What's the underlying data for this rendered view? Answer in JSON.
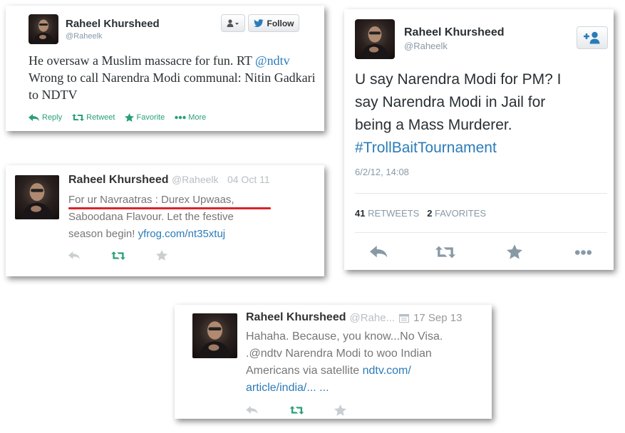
{
  "tweet1": {
    "name": "Raheel Khursheed",
    "handle": "@Raheelk",
    "follow_label": "Follow",
    "text_before": "He oversaw a Muslim massacre for fun. RT",
    "mention": "@ndtv",
    "text_after": "Wrong to call Narendra Modi communal: Nitin Gadkari to NDTV",
    "actions": {
      "reply": "Reply",
      "retweet": "Retweet",
      "favorite": "Favorite",
      "more": "More"
    }
  },
  "tweet2": {
    "name": "Raheel Khursheed",
    "handle": "@Raheelk",
    "text_line1": "U say Narendra Modi for PM? I",
    "text_line2": "say Narendra Modi in Jail for",
    "text_line3": "being a Mass Murderer.",
    "hashtag": "#TrollBaitTournament",
    "timestamp": "6/2/12, 14:08",
    "retweets_count": "41",
    "retweets_label": "RETWEETS",
    "favorites_count": "2",
    "favorites_label": "FAVORITES"
  },
  "tweet3": {
    "name": "Raheel Khursheed",
    "handle": "@Raheelk",
    "date": "04 Oct 11",
    "text_line1": "For ur Navraatras : Durex Upwaas,",
    "text_line2": "Saboodana Flavour. Let the festive",
    "text_line3_plain": "season begin!",
    "text_link": "yfrog.com/nt35xtuj"
  },
  "tweet4": {
    "name": "Raheel Khursheed",
    "handle": "@Rahe...",
    "date": "17 Sep 13",
    "text_line1": "Hahaha. Because, you know...No Visa.",
    "text_line2": ".@ndtv Narendra Modi to woo Indian",
    "text_line3_plain": "Americans via satellite",
    "text_link_1": "ndtv.com/",
    "text_link_2": "article/india/...",
    "text_ellipsis": "..."
  },
  "colors": {
    "retweet_green": "#2a9f7a",
    "link_blue": "#2b7bb9",
    "underline_red": "#d9232b"
  }
}
